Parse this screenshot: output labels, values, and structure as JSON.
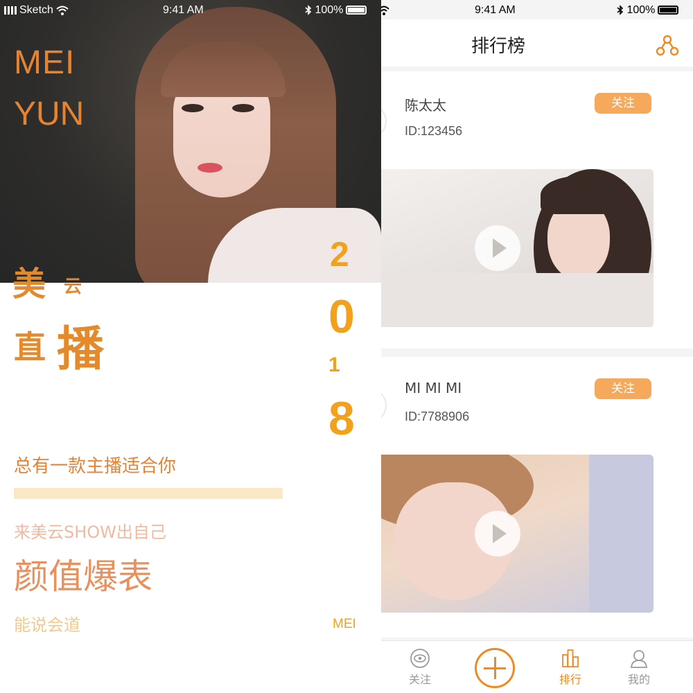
{
  "left_screen": {
    "status_bar": {
      "carrier": "Sketch",
      "time": "9:41 AM",
      "battery": "100%"
    },
    "brand_line1": "MEI",
    "brand_line2": "YUN",
    "title_char_1": "美",
    "title_char_2": "云",
    "title_char_3": "直",
    "title_char_4": "播",
    "year_digits": [
      "2",
      "0",
      "1",
      "8"
    ],
    "tagline": "总有一款主播适合你",
    "subtitle": "来美云SHOW出自己",
    "headline": "颜值爆表",
    "subtitle2": "能说会道",
    "corner_mark": "MEI",
    "accent_color": "#e48432"
  },
  "right_screen": {
    "status_bar": {
      "time": "9:41 AM",
      "battery": "100%"
    },
    "nav_title": "排行榜",
    "cards": [
      {
        "name": "陈太太",
        "id": "ID:123456",
        "follow_label": "关注"
      },
      {
        "name": "MI MI MI",
        "id": "ID:7788906",
        "follow_label": "关注"
      }
    ],
    "tabs": [
      {
        "label": "关注",
        "icon": "eye-icon",
        "active": false
      },
      {
        "label": "",
        "icon": "plus-icon",
        "active": false
      },
      {
        "label": "排行",
        "icon": "ranking-icon",
        "active": true
      },
      {
        "label": "我的",
        "icon": "profile-icon",
        "active": false
      }
    ],
    "accent_color": "#f08a20",
    "follow_button_color": "#f6a85b"
  }
}
